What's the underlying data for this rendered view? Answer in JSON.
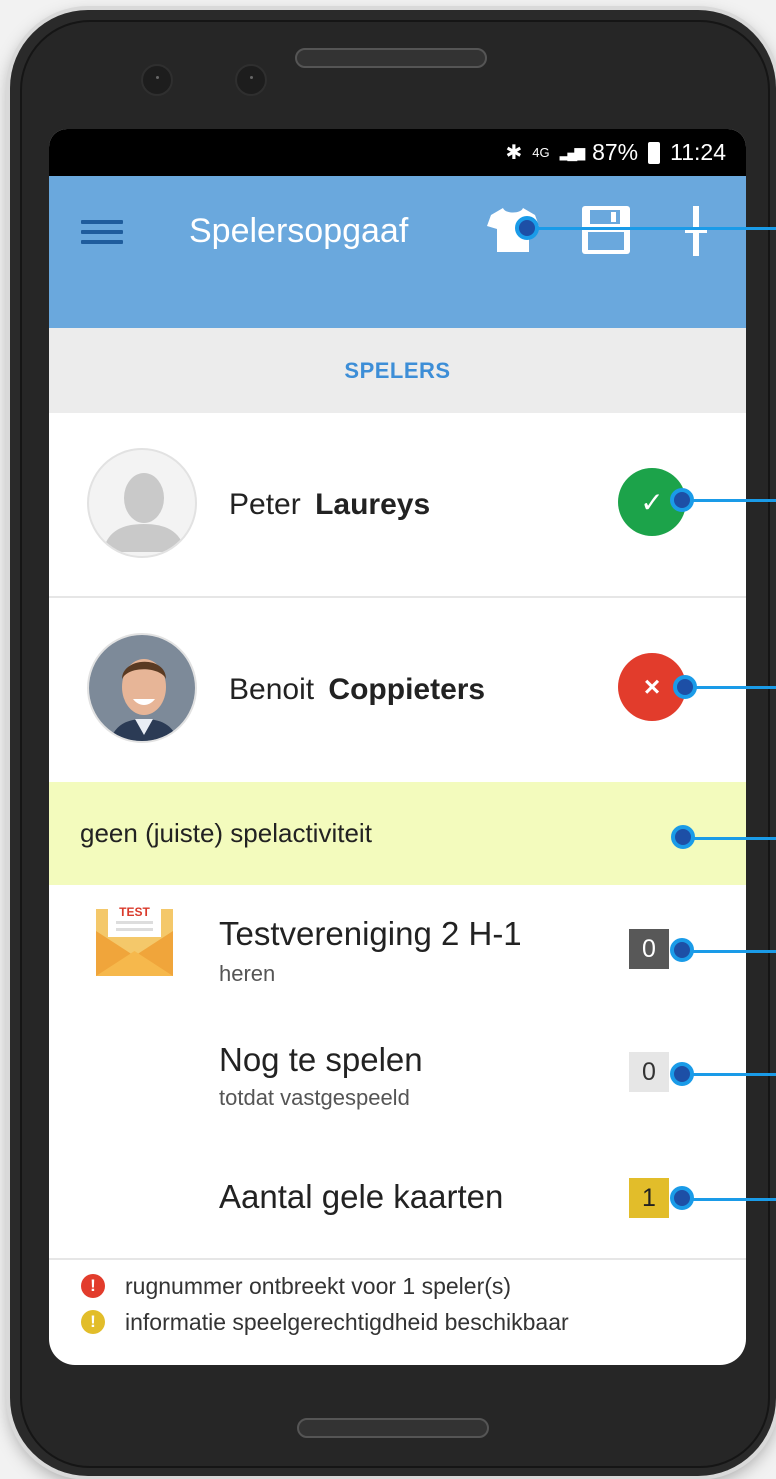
{
  "status_bar": {
    "bluetooth": "✱",
    "network": "4G",
    "signal": "▂▄▆",
    "battery": "87%",
    "time": "11:24"
  },
  "app_bar": {
    "title": "Spelersopgaaf",
    "icons": [
      "menu-icon",
      "shirt-icon",
      "save-icon",
      "more-icon"
    ],
    "color": "#6aa8dd"
  },
  "tabs": [
    {
      "label": "SPELERS",
      "active": true
    }
  ],
  "players": [
    {
      "first": "Peter",
      "last": "Laureys",
      "status": "ok",
      "status_symbol": "✓"
    },
    {
      "first": "Benoit",
      "last": "Coppieters",
      "status": "error",
      "status_symbol": "×"
    }
  ],
  "warning": {
    "text": "geen (juiste) spelactiviteit"
  },
  "team": {
    "badge_text": "TEST",
    "name": "Testvereniging 2 H-1",
    "subtitle": "heren",
    "count": "0"
  },
  "pending": {
    "title": "Nog te spelen",
    "subtitle": "totdat vastgespeeld",
    "count": "0"
  },
  "cards": {
    "title": "Aantal gele kaarten",
    "count": "1"
  },
  "footer": [
    {
      "icon": "!",
      "type": "error",
      "text": "rugnummer ontbreekt voor 1 speler(s)"
    },
    {
      "icon": "!",
      "type": "warning",
      "text": "informatie speelgerechtigdheid beschikbaar"
    }
  ],
  "colors": {
    "accent": "#6aa8dd",
    "ok": "#1ca34a",
    "error": "#e23c2c",
    "warning_bg": "#f3fbbd",
    "callout": "#1a9be8"
  }
}
